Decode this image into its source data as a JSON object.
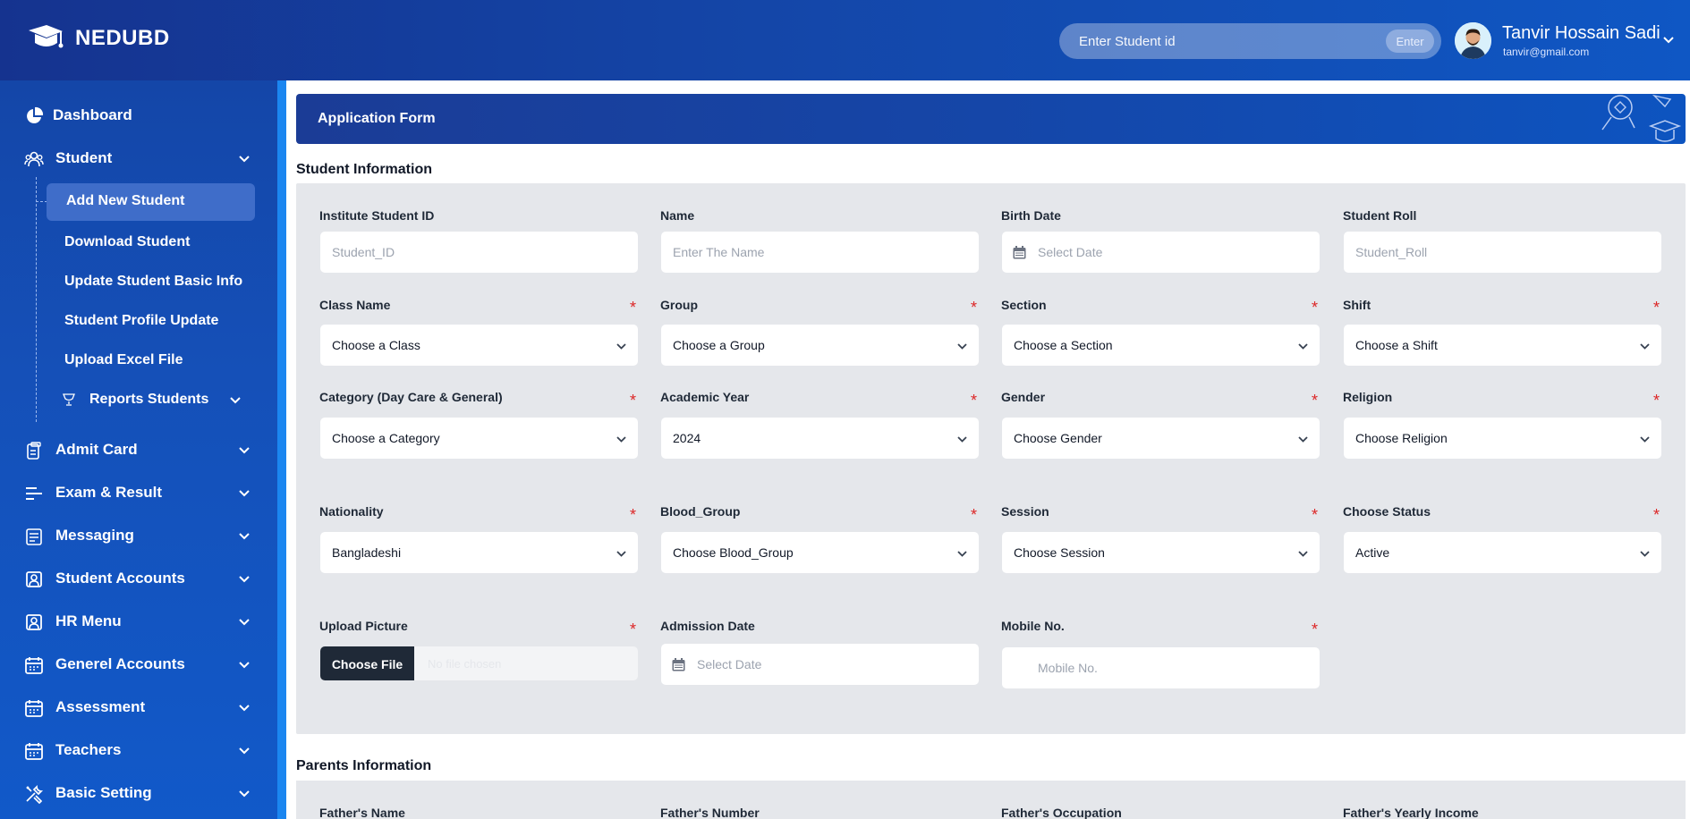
{
  "brand": {
    "name": "NEDUBD"
  },
  "search": {
    "placeholder": "Enter Student id",
    "button_label": "Enter"
  },
  "user": {
    "name": "Tanvir Hossain Sadi",
    "email": "tanvir@gmail.com"
  },
  "sidebar": {
    "items": [
      {
        "label": "Dashboard",
        "icon": "pie-chart-icon",
        "chevron": false
      },
      {
        "label": "Student",
        "icon": "users-icon",
        "chevron": true,
        "expanded": true
      },
      {
        "label": "Admit Card",
        "icon": "clipboard-icon",
        "chevron": true
      },
      {
        "label": "Exam & Result",
        "icon": "list-icon",
        "chevron": true
      },
      {
        "label": "Messaging",
        "icon": "message-icon",
        "chevron": true
      },
      {
        "label": "Student Accounts",
        "icon": "account-box-icon",
        "chevron": true
      },
      {
        "label": "HR Menu",
        "icon": "id-card-icon",
        "chevron": true
      },
      {
        "label": "Generel Accounts",
        "icon": "calendar-icon",
        "chevron": true
      },
      {
        "label": "Assessment",
        "icon": "calendar-icon",
        "chevron": true
      },
      {
        "label": "Teachers",
        "icon": "calendar-icon",
        "chevron": true
      },
      {
        "label": "Basic Setting",
        "icon": "tools-icon",
        "chevron": true
      }
    ],
    "student_sub": [
      {
        "label": "Add New Student",
        "active": true
      },
      {
        "label": "Download Student"
      },
      {
        "label": "Update Student Basic Info"
      },
      {
        "label": "Student Profile Update"
      },
      {
        "label": "Upload Excel File"
      },
      {
        "label": "Reports Students",
        "icon": "award-icon",
        "chevron": true
      }
    ]
  },
  "page": {
    "title": "Application Form",
    "student_section": "Student Information",
    "parents_section": "Parents Information"
  },
  "form": {
    "student_id": {
      "label": "Institute Student ID",
      "placeholder": "Student_ID"
    },
    "name": {
      "label": "Name",
      "placeholder": "Enter The  Name"
    },
    "birth_date": {
      "label": "Birth Date",
      "placeholder": "Select Date"
    },
    "roll": {
      "label": "Student Roll",
      "placeholder": "Student_Roll"
    },
    "class_name": {
      "label": "Class Name",
      "value": "Choose a Class",
      "required": true
    },
    "group": {
      "label": "Group",
      "value": "Choose a Group",
      "required": true
    },
    "section": {
      "label": "Section",
      "value": "Choose a Section",
      "required": true
    },
    "shift": {
      "label": "Shift",
      "value": "Choose a Shift",
      "required": true
    },
    "category": {
      "label": "Category (Day Care & General)",
      "value": "Choose a Category",
      "required": true
    },
    "academic_year": {
      "label": "Academic Year",
      "value": "2024",
      "required": true
    },
    "gender": {
      "label": "Gender",
      "value": "Choose Gender",
      "required": true
    },
    "religion": {
      "label": "Religion",
      "value": "Choose Religion",
      "required": true
    },
    "nationality": {
      "label": "Nationality",
      "value": "Bangladeshi",
      "required": true
    },
    "blood_group": {
      "label": "Blood_Group",
      "value": "Choose Blood_Group",
      "required": true
    },
    "session": {
      "label": "Session",
      "value": "Choose Session",
      "required": true
    },
    "status": {
      "label": "Choose Status",
      "value": "Active",
      "required": true
    },
    "picture": {
      "label": "Upload Picture",
      "button_label": "Choose File",
      "file_text": "No file chosen",
      "required": true
    },
    "admission_date": {
      "label": "Admission Date",
      "placeholder": "Select Date"
    },
    "mobile": {
      "label": "Mobile No.",
      "placeholder": "Mobile No.",
      "required": true
    }
  },
  "parents": {
    "father_name": "Father's Name",
    "father_number": "Father's Number",
    "father_occupation": "Father's Occupation",
    "father_income": "Father's Yearly Income"
  },
  "required_mark": "*"
}
